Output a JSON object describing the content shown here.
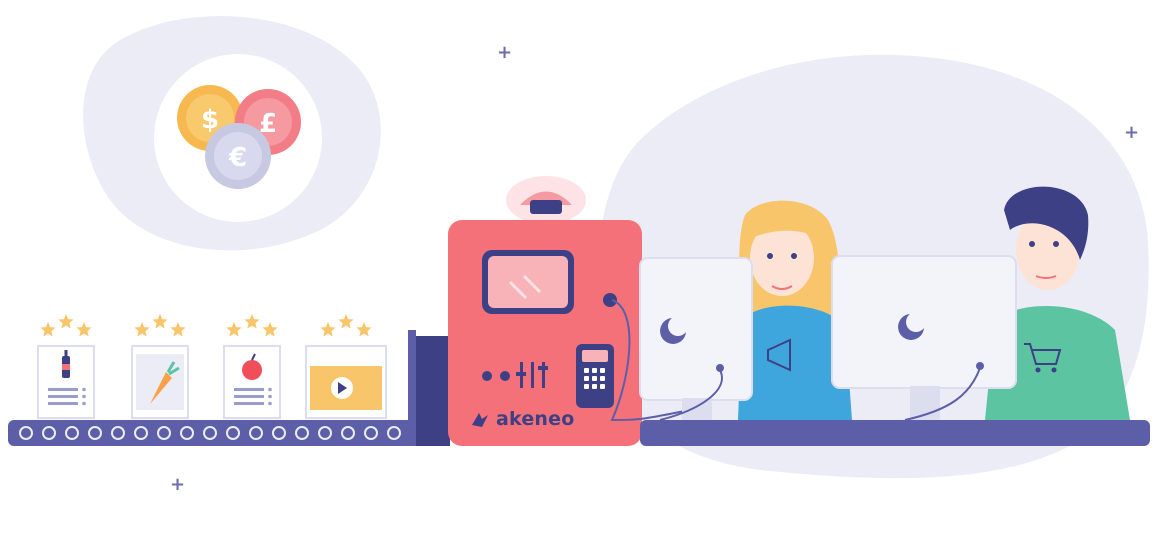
{
  "brand": {
    "name": "akeneo",
    "color": "#3e4085",
    "accent": "#f47179"
  },
  "currencies": [
    "$",
    "£",
    "€"
  ],
  "colors": {
    "blob": "#ebecf6",
    "belt": "#5c5fa8",
    "belt_dark": "#3e4085",
    "machine": "#f47179",
    "star": "#f9c56a",
    "screen": "#f3f4fa"
  },
  "conveyor_items": [
    {
      "stars": 3,
      "content": "wine-bottle-icon"
    },
    {
      "stars": 3,
      "content": "carrot-icon"
    },
    {
      "stars": 3,
      "content": "apple-icon"
    },
    {
      "stars": 3,
      "content": "video-play-icon"
    }
  ],
  "sparkle": "+"
}
